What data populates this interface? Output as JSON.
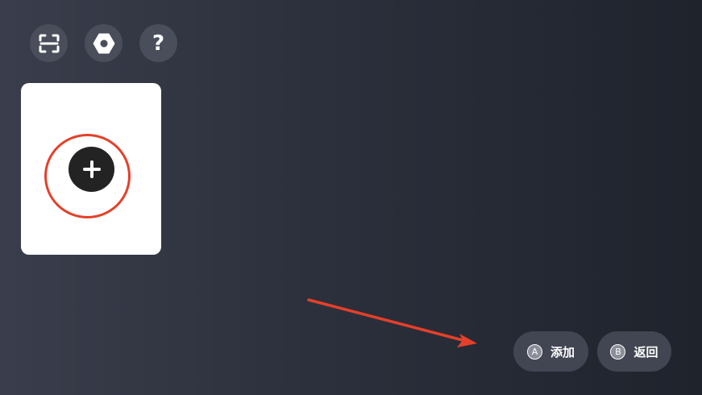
{
  "toolbar": {
    "icons": [
      {
        "name": "scan-icon"
      },
      {
        "name": "hexagon-settings-icon"
      },
      {
        "name": "help-icon",
        "glyph": "?"
      }
    ]
  },
  "card": {
    "action_icon": "plus-icon"
  },
  "hints": {
    "add": {
      "key": "A",
      "label": "添加"
    },
    "back": {
      "key": "B",
      "label": "返回"
    }
  },
  "colors": {
    "annotation": "#e5402a",
    "button_bg": "#4a4e5b",
    "card_bg": "#ffffff",
    "add_circle": "#232323"
  }
}
